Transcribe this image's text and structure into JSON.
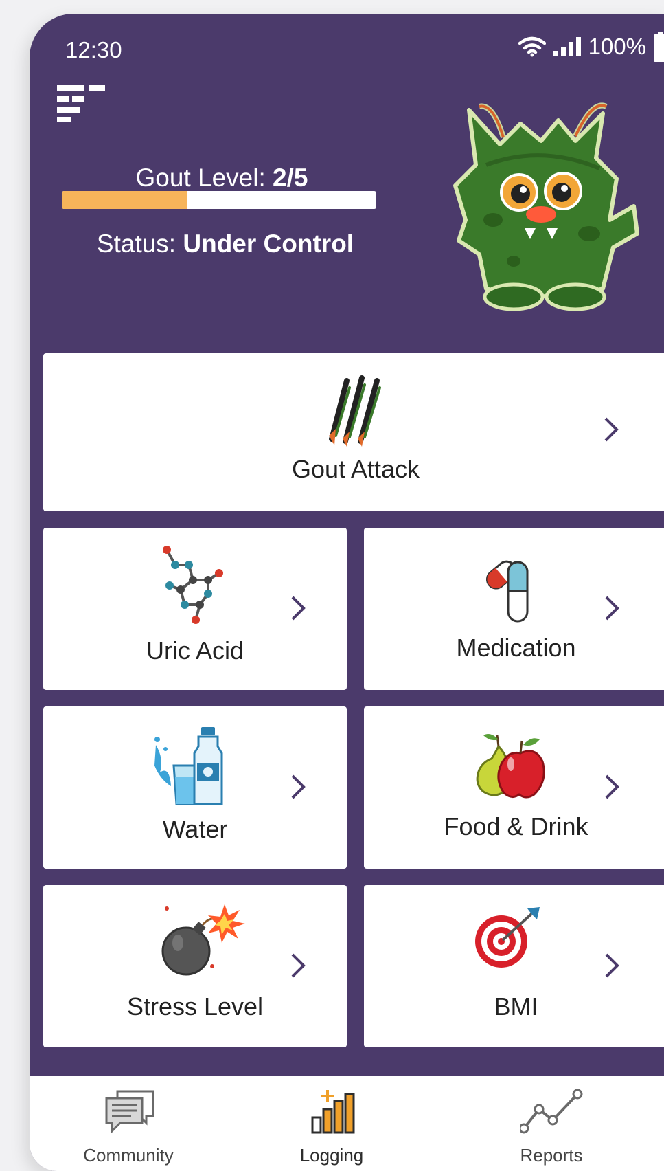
{
  "status_bar": {
    "time": "12:30",
    "battery": "100%",
    "icons": [
      "wifi-icon",
      "signal-icon",
      "battery-icon"
    ]
  },
  "header": {
    "gout_level_label": "Gout Level:",
    "gout_level_value": "2/5",
    "gout_level_fraction": 0.4,
    "status_label": "Status:",
    "status_value": "Under Control",
    "menu_icon": "menu-icon",
    "mascot": "gout-monster-mascot"
  },
  "tiles": [
    {
      "label": "Gout Attack",
      "icon": "claw-scratch-icon"
    },
    {
      "label": "Uric Acid",
      "icon": "molecule-icon"
    },
    {
      "label": "Medication",
      "icon": "pill-capsule-icon"
    },
    {
      "label": "Water",
      "icon": "water-bottle-icon"
    },
    {
      "label": "Food & Drink",
      "icon": "apple-pear-icon"
    },
    {
      "label": "Stress Level",
      "icon": "bomb-icon"
    },
    {
      "label": "BMI",
      "icon": "target-icon"
    }
  ],
  "bottom_nav": [
    {
      "label": "Community",
      "icon": "chat-bubbles-icon"
    },
    {
      "label": "Logging",
      "icon": "bar-chart-plus-icon",
      "active": true
    },
    {
      "label": "Reports",
      "icon": "line-graph-icon"
    }
  ],
  "colors": {
    "background": "#4b3a6b",
    "progress_fill": "#f7b45a",
    "chevron": "#4b3a6b",
    "accent_orange": "#f0a02a"
  }
}
